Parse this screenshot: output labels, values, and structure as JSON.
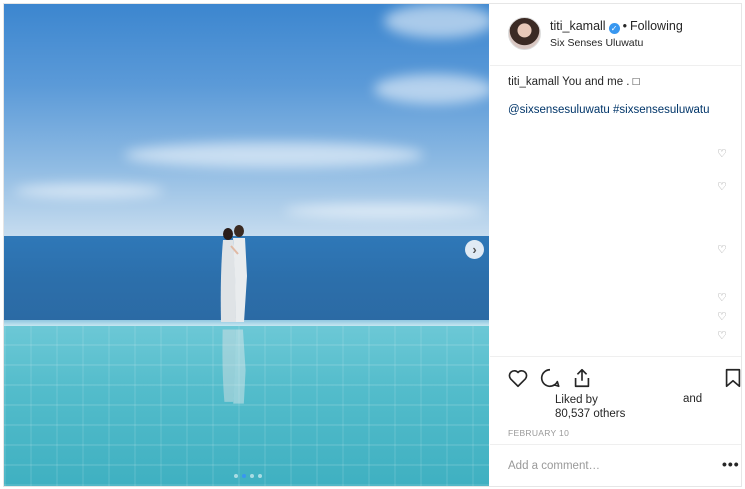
{
  "post": {
    "username": "titi_kamall",
    "following_label": "Following",
    "bullet": "•",
    "location": "Six Senses Uluwatu",
    "caption_user": "titi_kamall",
    "caption_text": "You and me . □",
    "tags": "@sixsensesuluwatu #sixsensesuluwatu",
    "liked_by_prefix": "Liked by",
    "likes_count": "80,537 others",
    "liked_and": "and",
    "date": "FEBRUARY 10",
    "comment_placeholder": "Add a comment…",
    "more": "•••"
  },
  "carousel": {
    "slide_count": 4,
    "active_index": 1
  },
  "icons": {
    "verified": "verified-badge-icon",
    "next": "chevron-right-icon",
    "like": "heart-icon",
    "comment": "comment-icon",
    "share": "share-icon",
    "save": "bookmark-icon"
  },
  "colors": {
    "verified": "#3897f0",
    "link": "#003569",
    "muted": "#999999",
    "text": "#262626"
  }
}
